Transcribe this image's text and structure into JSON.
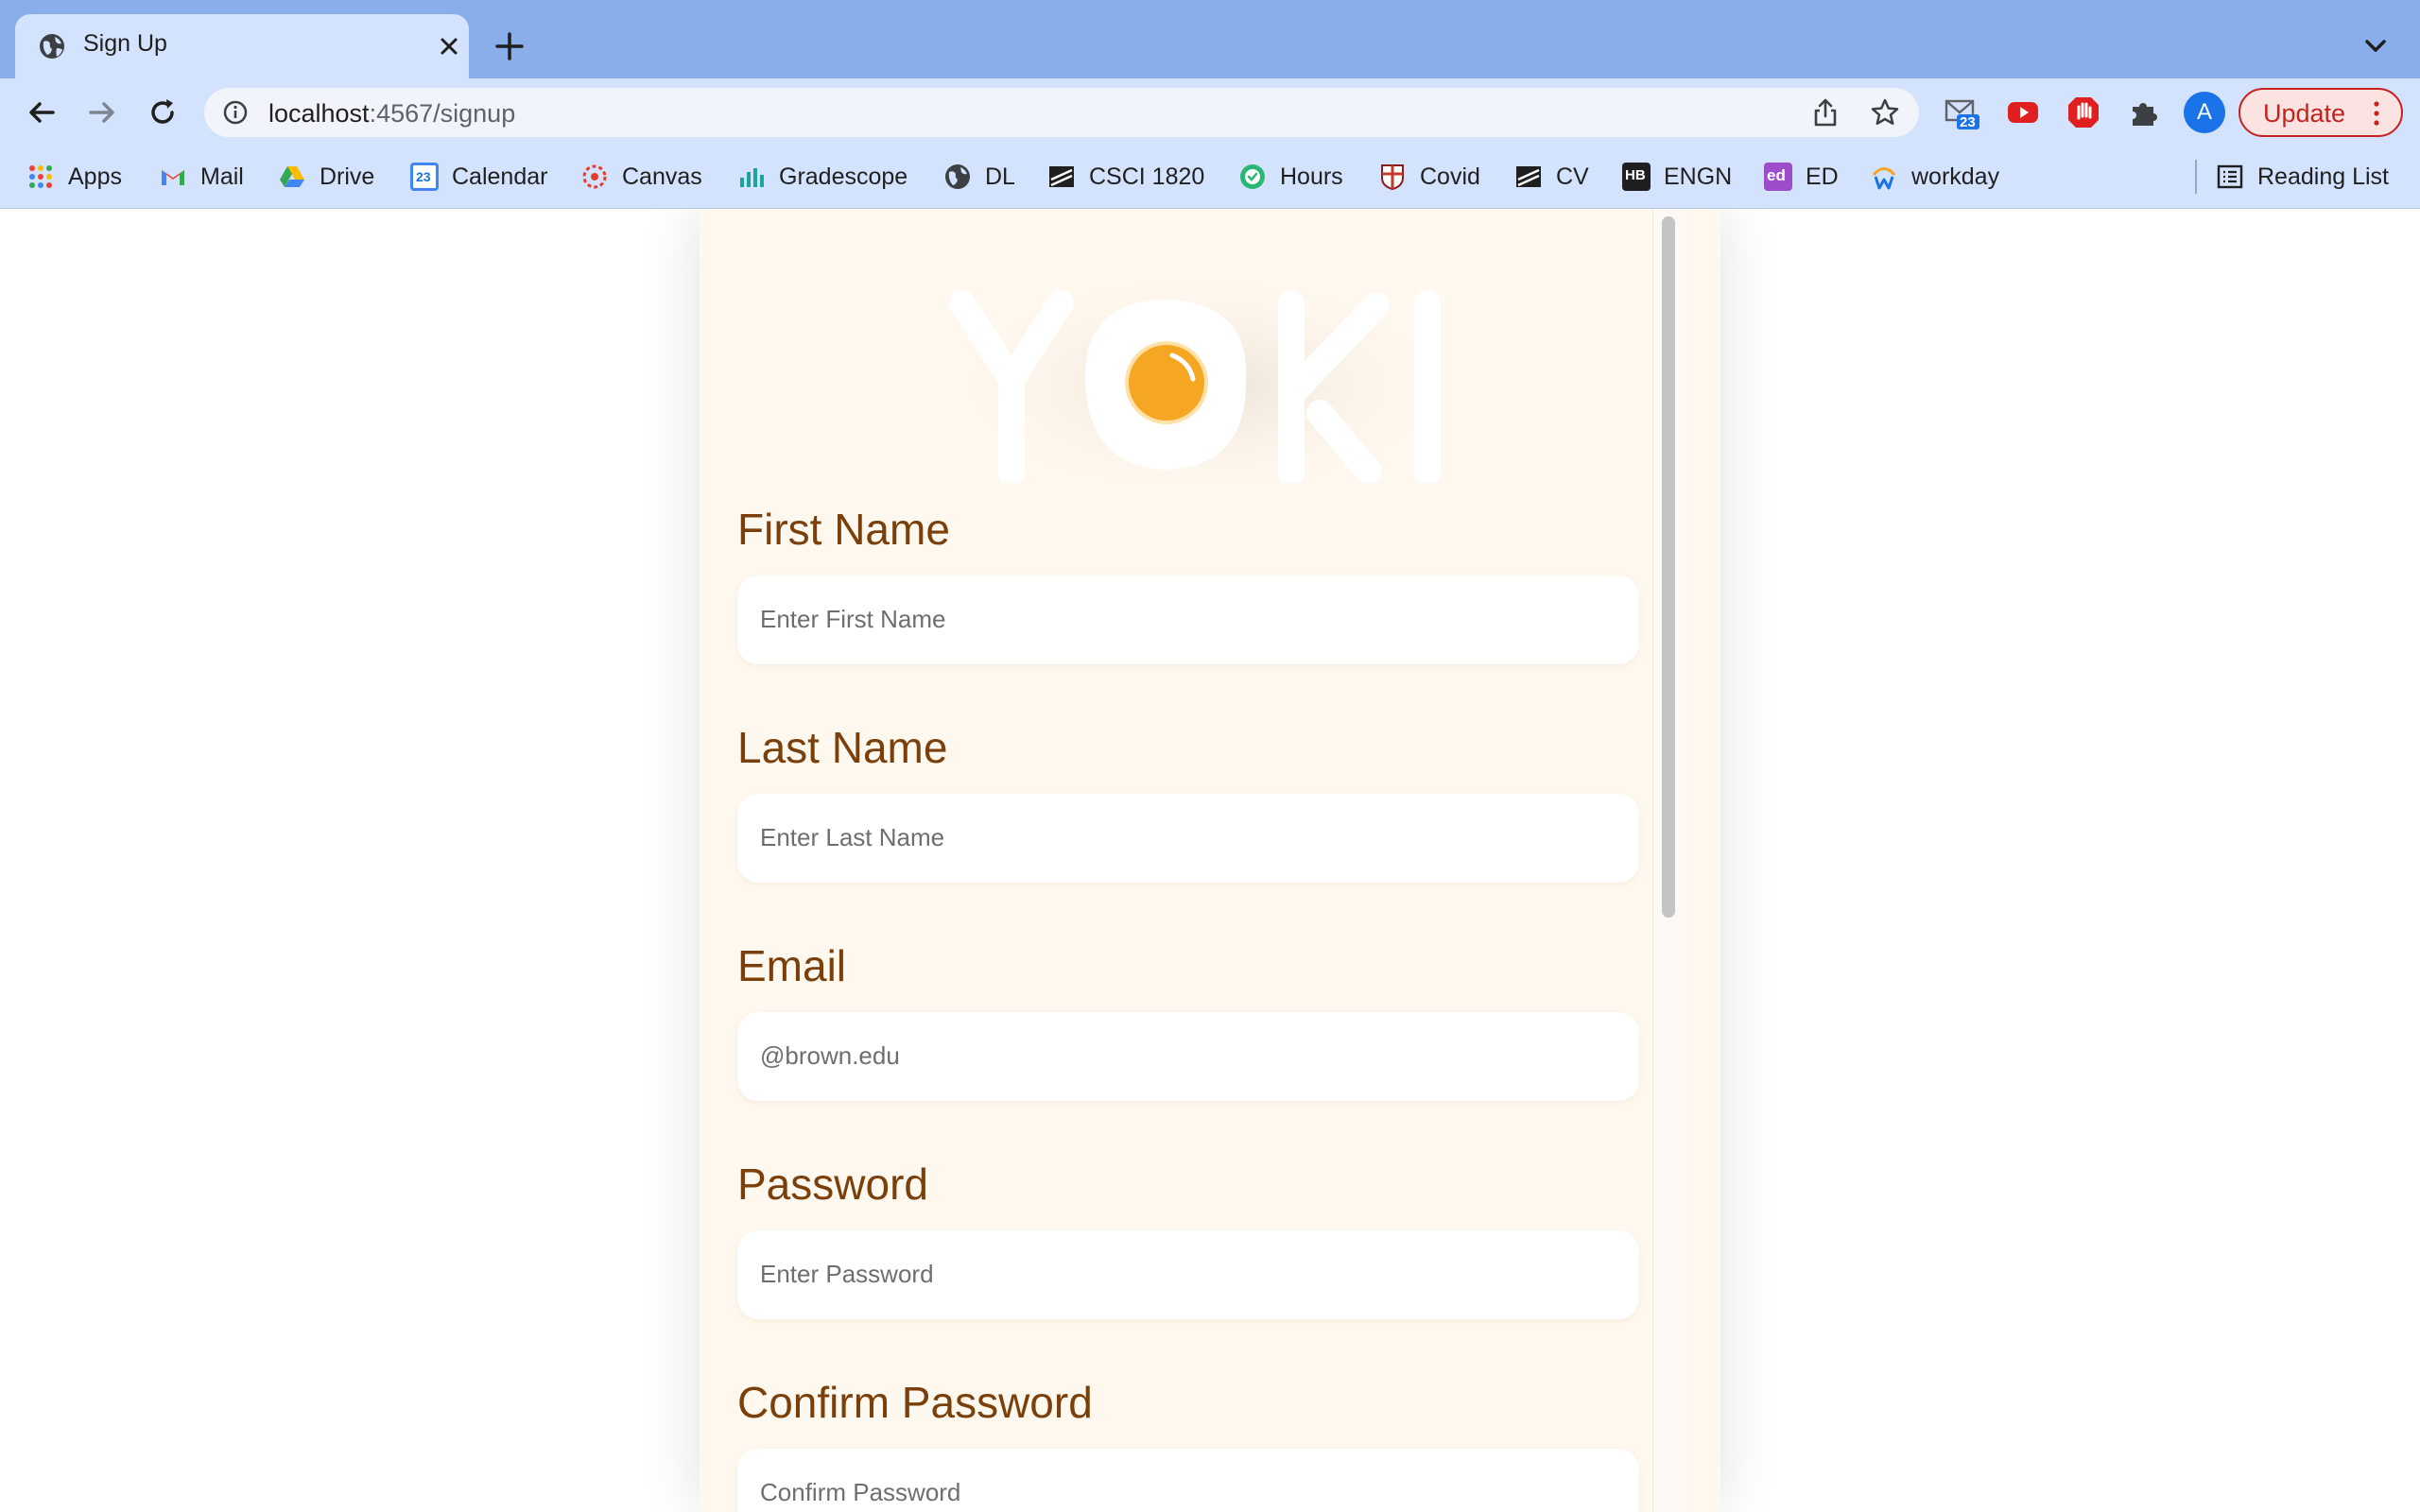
{
  "browser": {
    "tab": {
      "title": "Sign Up"
    },
    "address": {
      "host": "localhost",
      "path": ":4567/signup"
    },
    "update_label": "Update",
    "profile_initial": "A",
    "mail_badge": "23",
    "bookmarks": [
      {
        "label": "Apps",
        "icon": "apps-grid-icon"
      },
      {
        "label": "Mail",
        "icon": "gmail-icon"
      },
      {
        "label": "Drive",
        "icon": "drive-icon"
      },
      {
        "label": "Calendar",
        "icon": "calendar-icon",
        "badge": "23"
      },
      {
        "label": "Canvas",
        "icon": "canvas-icon"
      },
      {
        "label": "Gradescope",
        "icon": "gradescope-icon"
      },
      {
        "label": "DL",
        "icon": "globe-icon"
      },
      {
        "label": "CSCI 1820",
        "icon": "course-icon"
      },
      {
        "label": "Hours",
        "icon": "hours-check-icon"
      },
      {
        "label": "Covid",
        "icon": "brown-shield-icon"
      },
      {
        "label": "CV",
        "icon": "course-icon"
      },
      {
        "label": "ENGN",
        "icon": "hb-icon",
        "badge": "HB"
      },
      {
        "label": "ED",
        "icon": "ed-icon",
        "badge": "ed"
      },
      {
        "label": "workday",
        "icon": "workday-icon"
      }
    ],
    "reading_list": "Reading List"
  },
  "colors": {
    "label": "#7a3f0a",
    "card": "#fff8ee",
    "yolk": "#f5a623"
  },
  "form": {
    "fields": [
      {
        "label": "First Name",
        "placeholder": "Enter First Name"
      },
      {
        "label": "Last Name",
        "placeholder": "Enter Last Name"
      },
      {
        "label": "Email",
        "placeholder": "@brown.edu"
      },
      {
        "label": "Password",
        "placeholder": "Enter Password"
      },
      {
        "label": "Confirm Password",
        "placeholder": "Confirm Password"
      }
    ]
  }
}
